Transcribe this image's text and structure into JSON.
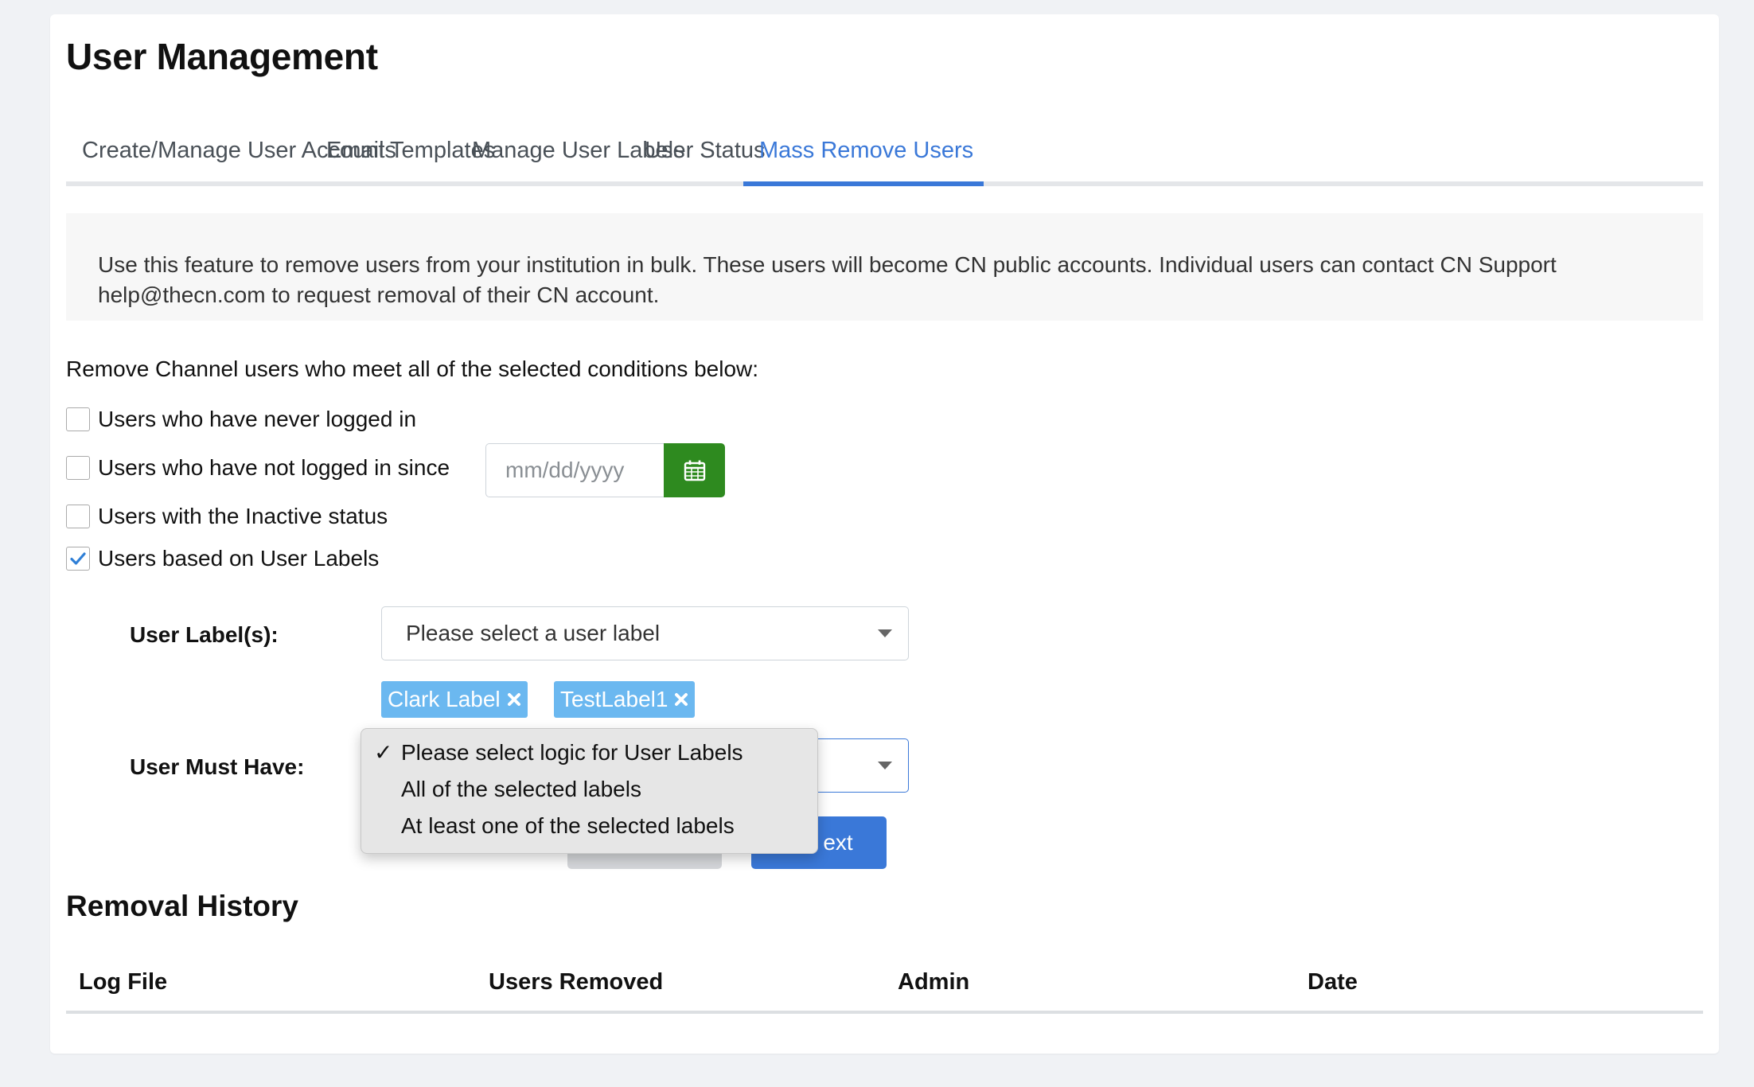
{
  "page": {
    "title": "User Management"
  },
  "tabs": [
    {
      "label": "Create/Manage User Accounts",
      "active": false
    },
    {
      "label": "Email Templates",
      "active": false
    },
    {
      "label": "Manage User Labels",
      "active": false
    },
    {
      "label": "User Status",
      "active": false
    },
    {
      "label": "Mass Remove Users",
      "active": true
    }
  ],
  "info": {
    "text": "Use this feature to remove users from your institution in bulk. These users will become CN public accounts. Individual users can contact CN Support help@thecn.com to request removal of their CN account."
  },
  "conditions": {
    "intro": "Remove Channel users who meet all of the selected conditions below:",
    "items": [
      {
        "label": "Users who have never logged in",
        "checked": false
      },
      {
        "label": "Users who have not logged in since",
        "checked": false
      },
      {
        "label": "Users with the Inactive status",
        "checked": false
      },
      {
        "label": "Users based on User Labels",
        "checked": true
      }
    ],
    "date_placeholder": "mm/dd/yyyy",
    "date_value": ""
  },
  "labels_form": {
    "user_labels_label": "User Label(s):",
    "select_placeholder": "Please select a user label",
    "chips": [
      "Clark Label",
      "TestLabel1"
    ],
    "must_have_label": "User Must Have:",
    "logic_options": [
      {
        "label": "Please select logic for User Labels",
        "selected": true
      },
      {
        "label": "All of the selected labels",
        "selected": false
      },
      {
        "label": "At least one of the selected labels",
        "selected": false
      }
    ]
  },
  "actions": {
    "cancel_label": "",
    "next_label": "ext"
  },
  "history": {
    "title": "Removal History",
    "columns": [
      "Log File",
      "Users Removed",
      "Admin",
      "Date"
    ]
  },
  "colors": {
    "accent": "#3a78d8",
    "calendar_button": "#2e8a1f",
    "chip": "#6bb8f0",
    "background": "#f0f2f5"
  }
}
